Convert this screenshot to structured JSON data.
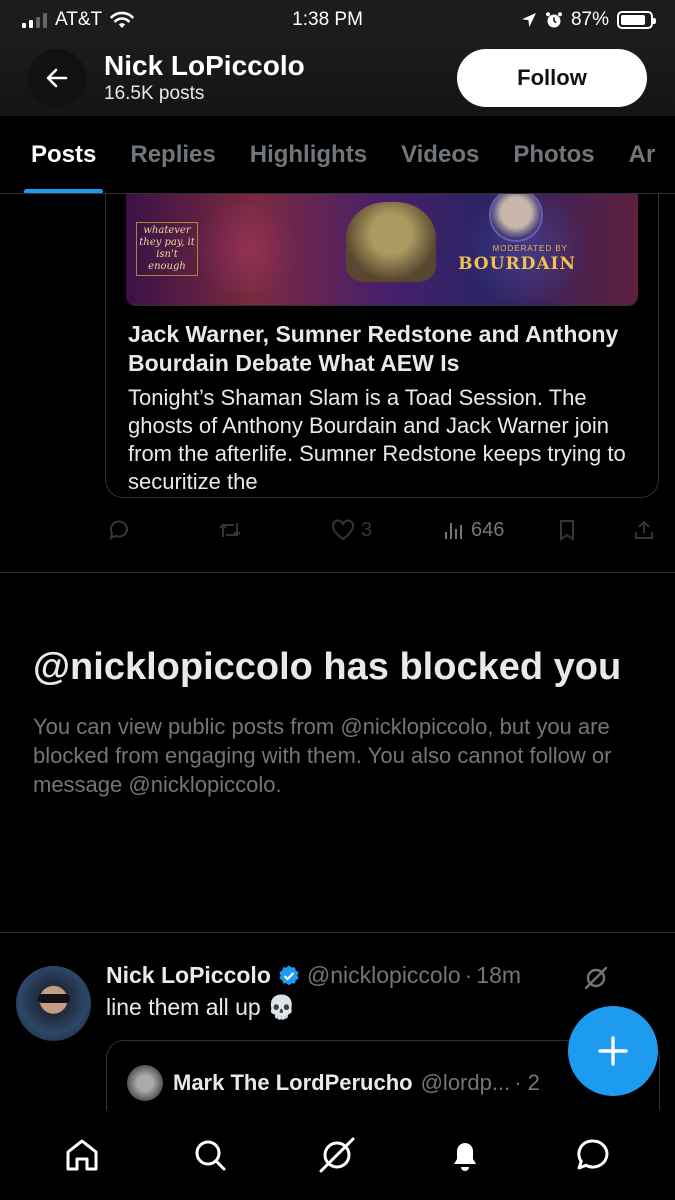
{
  "status_bar": {
    "carrier": "AT&T",
    "time": "1:38 PM",
    "battery": "87%",
    "battery_level": 0.87
  },
  "header": {
    "name": "Nick LoPiccolo",
    "post_count": "16.5K posts",
    "follow_label": "Follow"
  },
  "tabs": [
    "Posts",
    "Replies",
    "Highlights",
    "Videos",
    "Photos",
    "Ar"
  ],
  "active_tab": "Posts",
  "card": {
    "image_text_left": "whatever they pay, it isn't enough",
    "image_moderated": "MODERATED BY",
    "image_bourdain": "BOURDAIN",
    "title": "Jack Warner, Sumner Redstone and Anthony Bourdain Debate What AEW Is",
    "description": "Tonight’s Shaman Slam is a Toad Session. The ghosts of Anthony Bourdain and Jack Warner join from the afterlife. Sumner Redstone keeps trying to securitize the"
  },
  "post_actions": {
    "likes": "3",
    "views": "646"
  },
  "blocked": {
    "title": "@nicklopiccolo has blocked you",
    "description": "You can view public posts from @nicklopiccolo, but you are blocked from engaging with them. You also cannot follow or message @nicklopiccolo."
  },
  "tweet": {
    "name": "Nick LoPiccolo",
    "handle": "@nicklopiccolo",
    "separator": "·",
    "time": "18m",
    "text": "line them all up 💀",
    "quote": {
      "name": "Mark The LordPerucho",
      "handle": "@lordp...",
      "trailing": "· 2"
    }
  },
  "colors": {
    "accent": "#1d9bf0",
    "background": "#000000",
    "muted_text": "#71767b",
    "border": "#2f3336"
  },
  "icons": {
    "back": "arrow-left-icon",
    "reply": "reply-icon",
    "repost": "repost-icon",
    "like": "heart-icon",
    "views": "views-icon",
    "bookmark": "bookmark-icon",
    "share": "share-icon",
    "grok": "grok-icon",
    "verified": "verified-badge-icon",
    "compose": "plus-icon",
    "nav": [
      "home-icon",
      "search-icon",
      "grok-icon",
      "notifications-icon",
      "messages-icon"
    ]
  }
}
